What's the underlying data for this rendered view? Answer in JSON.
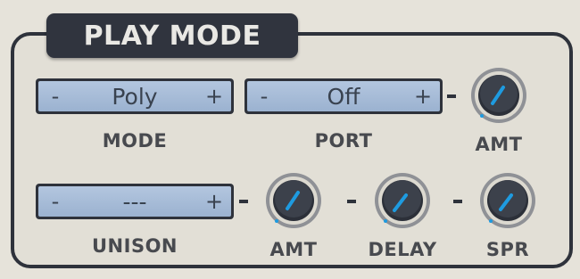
{
  "panel": {
    "title": "PLAY MODE"
  },
  "mode": {
    "minus": "-",
    "value": "Poly",
    "plus": "+",
    "label": "MODE"
  },
  "port": {
    "minus": "-",
    "value": "Off",
    "plus": "+",
    "label": "PORT"
  },
  "unison": {
    "minus": "-",
    "value": "---",
    "plus": "+",
    "label": "UNISON"
  },
  "knobs": {
    "port_amt": {
      "label": "AMT"
    },
    "unison_amt": {
      "label": "AMT"
    },
    "delay": {
      "label": "DELAY"
    },
    "spread": {
      "label": "SPR"
    }
  },
  "colors": {
    "lcd": "#a7bcd8",
    "frame": "#2e323b",
    "indicator": "#1e9be0"
  }
}
